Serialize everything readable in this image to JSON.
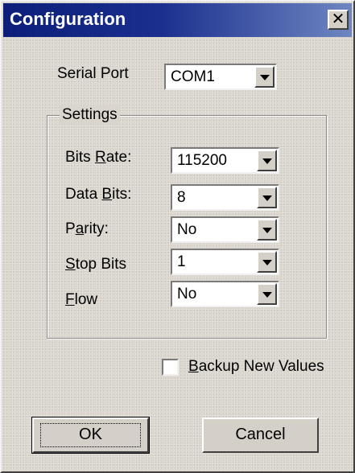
{
  "window": {
    "title": "Configuration",
    "close_glyph": "✕"
  },
  "serial_port": {
    "label": "Serial Port",
    "value": "COM1"
  },
  "settings": {
    "legend": "Settings",
    "bits_rate": {
      "label_pre": "Bits ",
      "label_u": "R",
      "label_post": "ate:",
      "value": "115200"
    },
    "data_bits": {
      "label_pre": "Data ",
      "label_u": "B",
      "label_post": "its:",
      "value": "8"
    },
    "parity": {
      "label_pre": "P",
      "label_u": "a",
      "label_post": "rity:",
      "value": "No"
    },
    "stop_bits": {
      "label_pre": "",
      "label_u": "S",
      "label_post": "top Bits",
      "value": "1"
    },
    "flow": {
      "label_pre": "",
      "label_u": "F",
      "label_post": "low",
      "value": "No"
    }
  },
  "backup": {
    "label_u": "B",
    "label_post": "ackup New Values",
    "checked": false
  },
  "buttons": {
    "ok": "OK",
    "cancel": "Cancel"
  },
  "icons": [
    "close-icon",
    "chevron-down-icon"
  ],
  "colors": {
    "title_start": "#0c1e79",
    "title_end": "#6f86c2",
    "face": "#d4d0c8"
  }
}
